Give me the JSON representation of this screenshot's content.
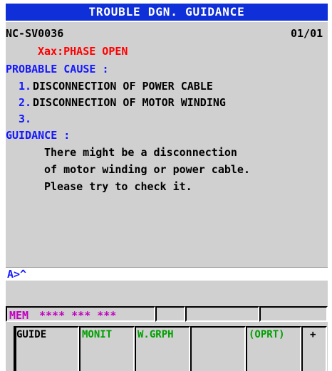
{
  "title": "TROUBLE DGN. GUIDANCE",
  "header": {
    "alarm_code": "NC-SV0036",
    "page": "01/01"
  },
  "alarm_message": "Xax:PHASE OPEN",
  "probable_cause": {
    "heading": "PROBABLE CAUSE :",
    "items": [
      {
        "number": "1.",
        "text": "DISCONNECTION OF POWER CABLE"
      },
      {
        "number": "2.",
        "text": "DISCONNECTION OF MOTOR WINDING"
      },
      {
        "number": "3.",
        "text": ""
      }
    ]
  },
  "guidance": {
    "heading": "GUIDANCE :",
    "lines": [
      "There might be a disconnection",
      "of motor winding or power cable.",
      "Please try to check it."
    ]
  },
  "command_line": "A>^",
  "status": {
    "mode": "MEM",
    "fields": "**** *** ***"
  },
  "softkeys": {
    "guide": "GUIDE",
    "monit": "MONIT",
    "wgrph": "W.GRPH",
    "blank": "",
    "oprt": "(OPRT)",
    "plus": "+"
  },
  "colors": {
    "title_bar": "#0f2fd8",
    "heading_blue": "#1418ff",
    "alarm_red": "#ff0000",
    "mode_magenta": "#c000c0",
    "softkey_green": "#00a000",
    "panel_gray": "#d0d0d0"
  }
}
